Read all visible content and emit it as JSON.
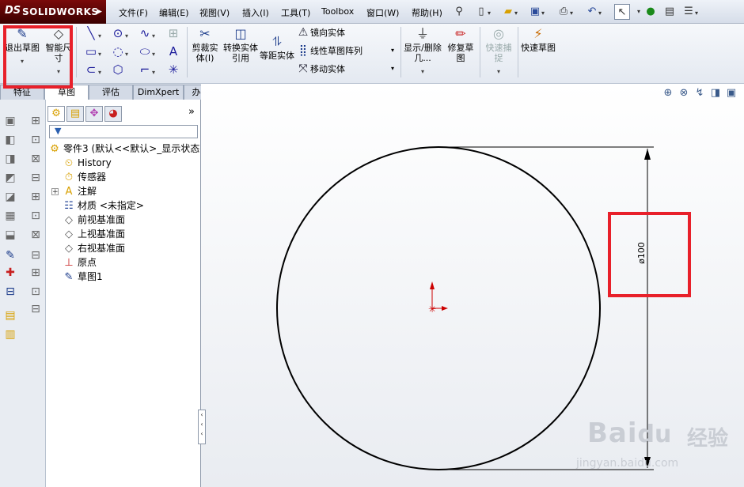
{
  "app": {
    "logo_prefix": "DS",
    "logo_text": "SOLIDWORKS",
    "logo_arrow": "▶"
  },
  "menu": [
    {
      "label": "文件(F)"
    },
    {
      "label": "编辑(E)"
    },
    {
      "label": "视图(V)"
    },
    {
      "label": "插入(I)"
    },
    {
      "label": "工具(T)"
    },
    {
      "label": "Toolbox"
    },
    {
      "label": "窗口(W)"
    },
    {
      "label": "帮助(H)"
    }
  ],
  "ribbon": {
    "exit_sketch": "退出草图",
    "smart_dimension": "智能尺寸",
    "trim_entities": "剪裁实体(I)",
    "convert_entities": "转换实体引用",
    "offset_entities": "等距实体",
    "mirror_entities": "镜向实体",
    "linear_pattern": "线性草图阵列",
    "move_entities": "移动实体",
    "display_delete": "显示/删除几...",
    "repair_sketch": "修复草图",
    "quick_snaps": "快速捕捉",
    "rapid_sketch": "快速草图"
  },
  "tabs": [
    {
      "label": "特征"
    },
    {
      "label": "草图"
    },
    {
      "label": "评估"
    },
    {
      "label": "DimXpert"
    },
    {
      "label": "办公室产品"
    }
  ],
  "tree": {
    "root": "零件3 (默认<<默认>_显示状态",
    "items": [
      {
        "label": "History"
      },
      {
        "label": "传感器"
      },
      {
        "label": "注解"
      },
      {
        "label": "材质 <未指定>"
      },
      {
        "label": "前视基准面"
      },
      {
        "label": "上视基准面"
      },
      {
        "label": "右视基准面"
      },
      {
        "label": "原点"
      },
      {
        "label": "草图1"
      }
    ],
    "collapse_label": "»"
  },
  "sketch": {
    "dimension_text": "ø100",
    "line_color": "#000000",
    "dim_color": "#5a3a1a",
    "origin_color": "#cc0000"
  },
  "watermark": {
    "brand": "Bai",
    "brand_cn": "经验",
    "url": "jingyan.baidu.com"
  },
  "colors": {
    "highlight": "#e8202a"
  }
}
